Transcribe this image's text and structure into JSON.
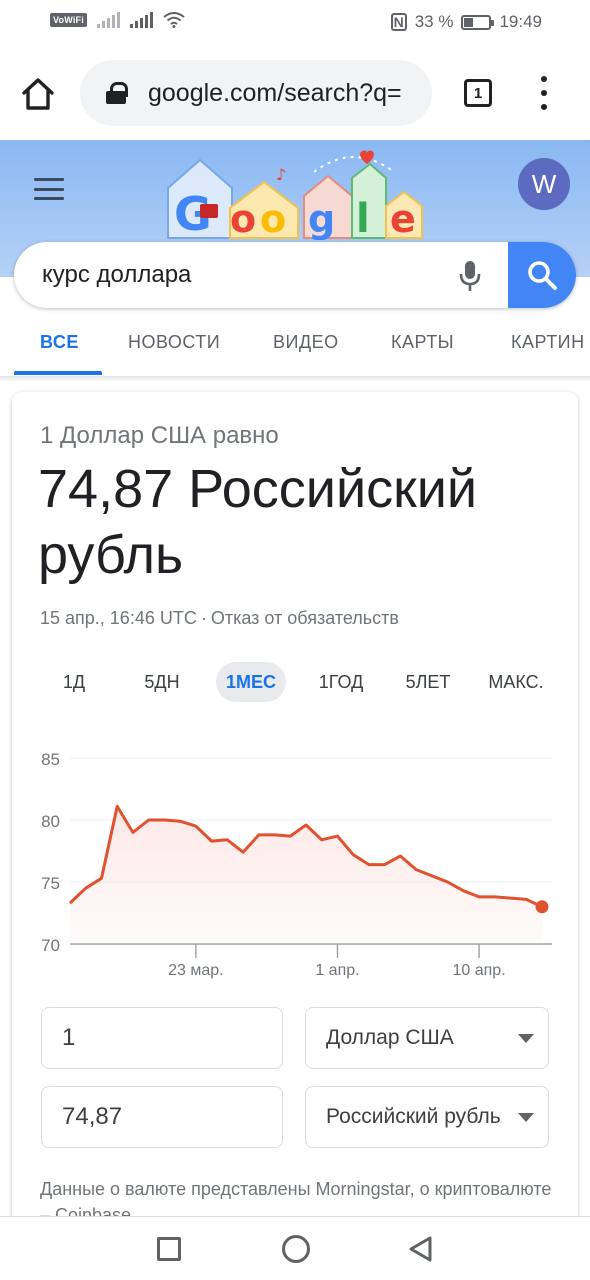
{
  "status_bar": {
    "vowifi": "VoWiFi",
    "battery_percent_text": "33 %",
    "battery_level": 0.33,
    "time": "19:49"
  },
  "browser": {
    "url": "google.com/search?q=",
    "tab_count": "1"
  },
  "header": {
    "avatar_letter": "W",
    "search_query": "курс доллара",
    "tabs": [
      {
        "label": "ВСЕ",
        "active": true
      },
      {
        "label": "НОВОСТИ",
        "active": false
      },
      {
        "label": "ВИДЕО",
        "active": false
      },
      {
        "label": "КАРТЫ",
        "active": false
      },
      {
        "label": "КАРТИН",
        "active": false
      }
    ]
  },
  "converter": {
    "equals_label": "1 Доллар США равно",
    "rate_line": "74,87 Российский рубль",
    "timestamp": "15 апр., 16:46 UTC",
    "separator": "·",
    "disclaimer_link": "Отказ от обязательств",
    "ranges": [
      "1Д",
      "5ДН",
      "1МЕС",
      "1ГОД",
      "5ЛЕТ",
      "МАКС."
    ],
    "active_range": "1МЕС",
    "amount_from": "1",
    "amount_to": "74,87",
    "currency_from": "Доллар США",
    "currency_to": "Российский рубль",
    "source_note": "Данные о валюте представлены Morningstar, о криптовалюте – Coinbase."
  },
  "chart_data": {
    "type": "area",
    "y_ticks": [
      "85",
      "80",
      "75",
      "70"
    ],
    "ylim": [
      70,
      85
    ],
    "x_tick_labels": [
      "23 мар.",
      "1 апр.",
      "10 апр."
    ],
    "x_tick_days": [
      8,
      17,
      26
    ],
    "x": [
      0,
      1,
      2,
      3,
      4,
      5,
      6,
      7,
      8,
      9,
      10,
      11,
      12,
      13,
      14,
      15,
      16,
      17,
      18,
      19,
      20,
      21,
      22,
      23,
      24,
      25,
      26,
      27,
      28,
      29,
      30
    ],
    "values": [
      73.3,
      74.5,
      75.3,
      81.1,
      79.0,
      80.0,
      80.0,
      79.9,
      79.5,
      78.3,
      78.4,
      77.4,
      78.8,
      78.8,
      78.7,
      79.6,
      78.4,
      78.7,
      77.2,
      76.4,
      76.4,
      77.1,
      76.0,
      75.5,
      75.0,
      74.3,
      73.8,
      73.8,
      73.7,
      73.6,
      73.0
    ],
    "line_color": "#e0522f",
    "fill_color": "#fce8e6",
    "grid": true
  }
}
